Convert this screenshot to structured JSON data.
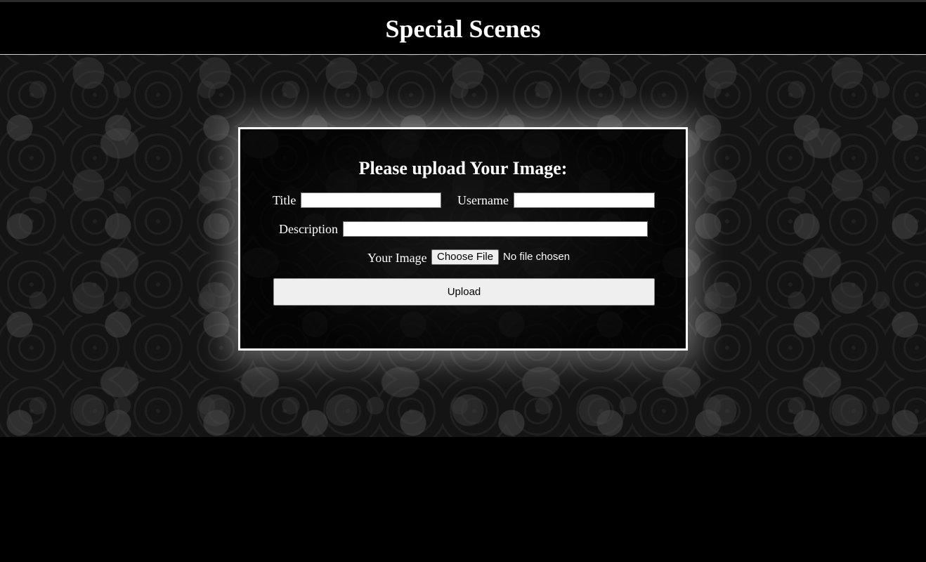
{
  "header": {
    "title": "Special Scenes"
  },
  "form": {
    "heading": "Please upload Your Image:",
    "title_label": "Title",
    "title_value": "",
    "username_label": "Username",
    "username_value": "",
    "description_label": "Description",
    "description_value": "",
    "image_label": "Your Image",
    "choose_file_label": "Choose File",
    "file_status": "No file chosen",
    "upload_label": "Upload"
  },
  "colors": {
    "background": "#000000",
    "text": "#ffffff",
    "panel_border": "#ffffff",
    "button_bg": "#efefef"
  }
}
